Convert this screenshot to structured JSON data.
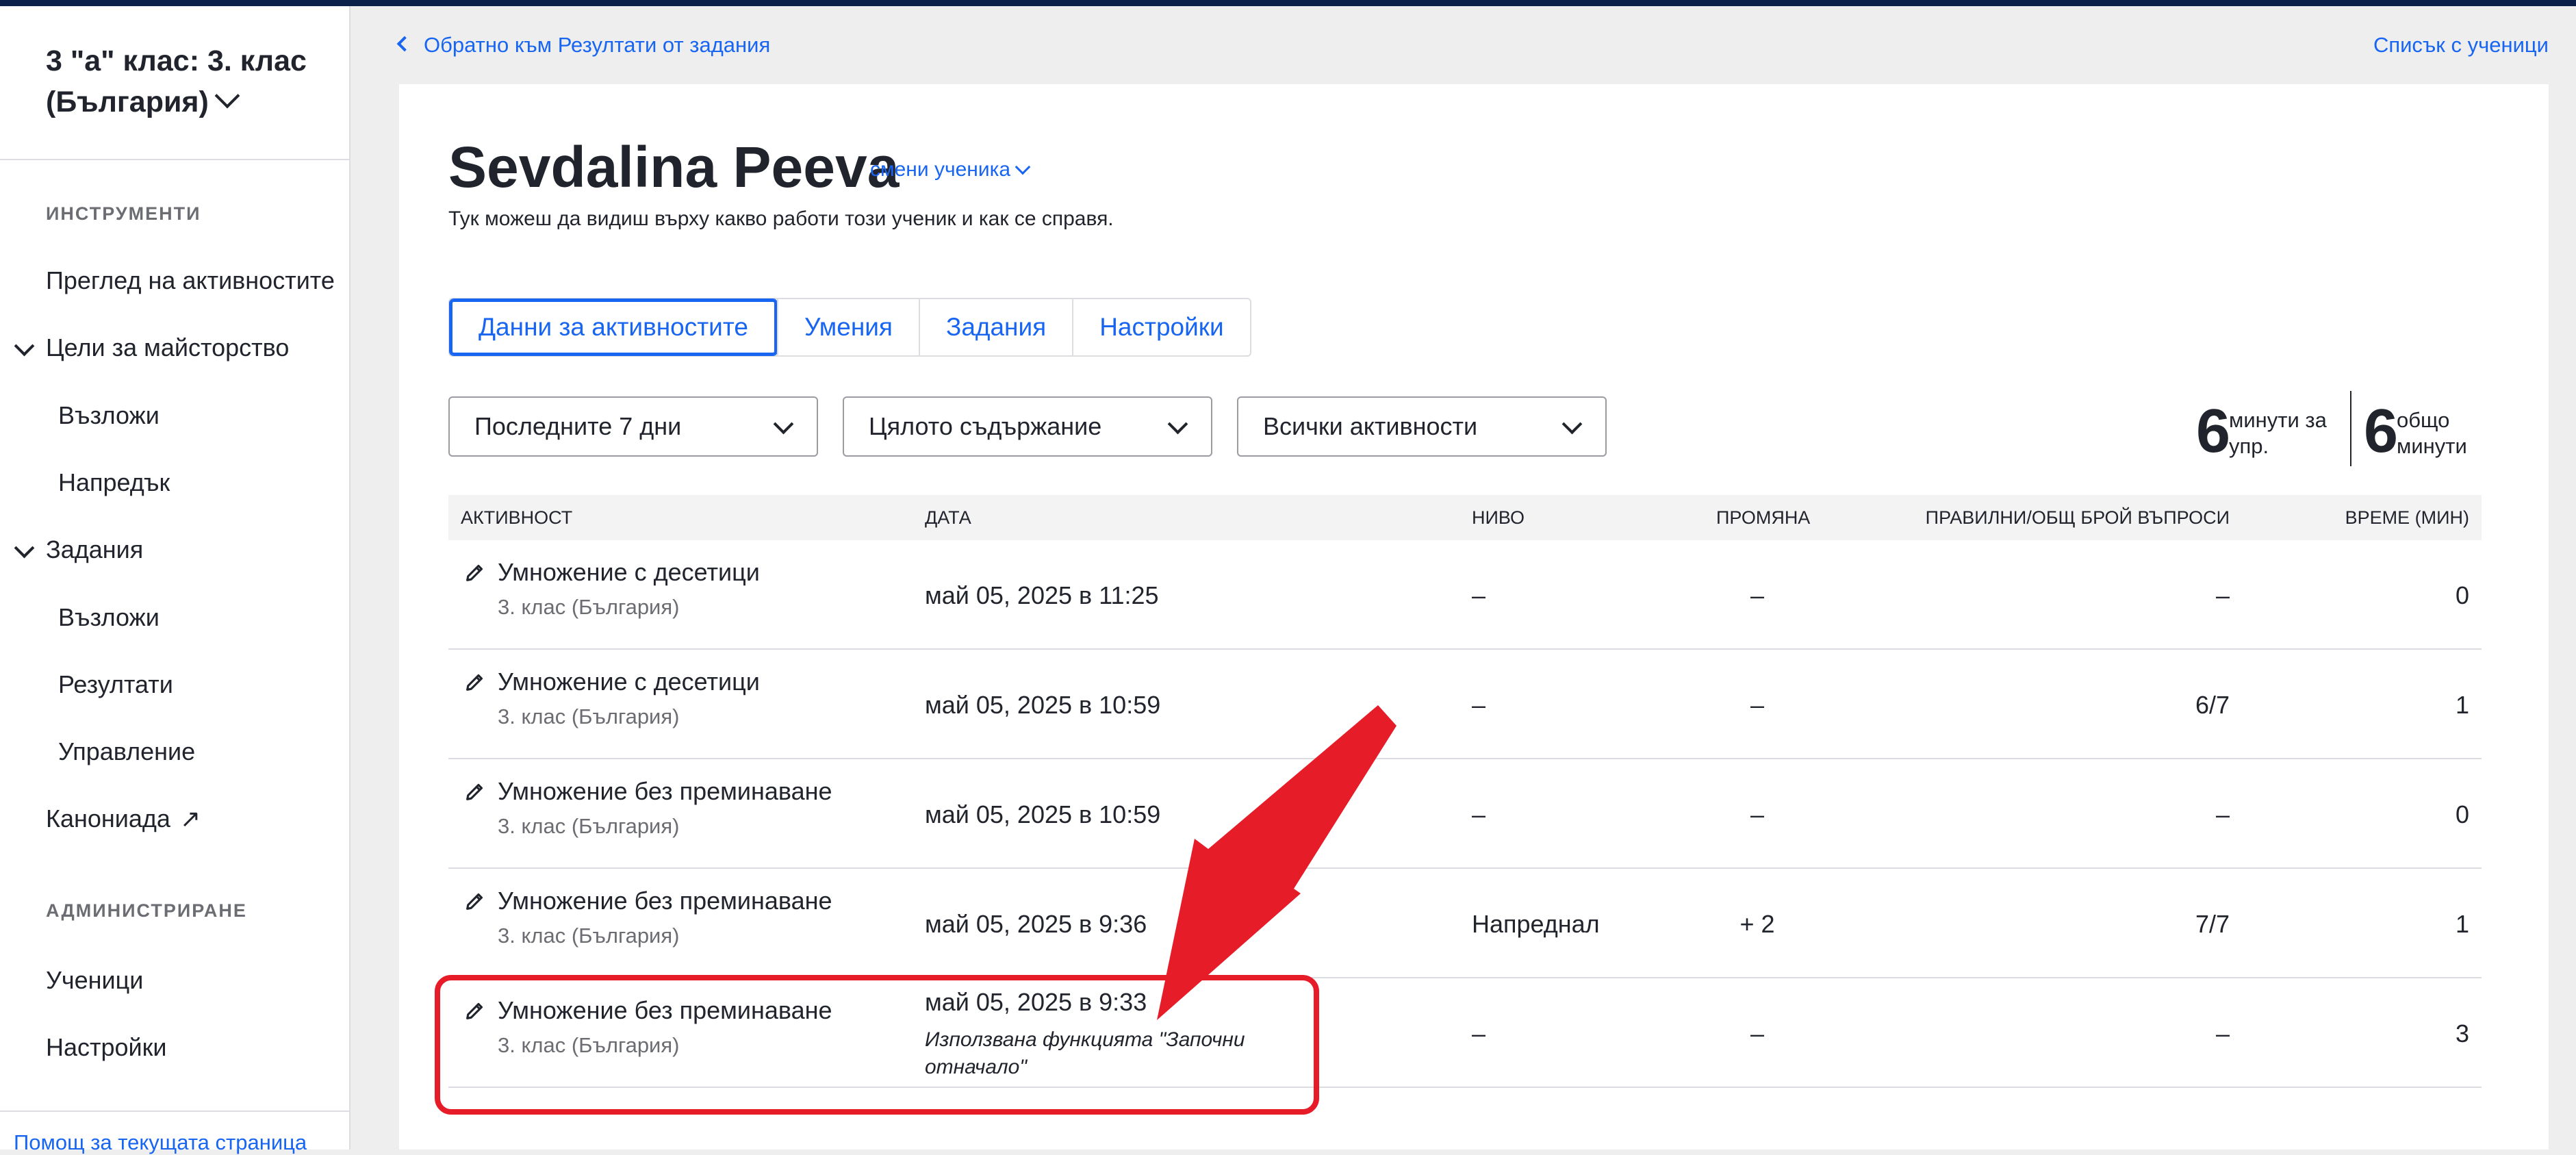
{
  "sidebar": {
    "class_title": "3 \"а\" клас: 3. клас (България)",
    "tools_label": "ИНСТРУМЕНТИ",
    "admin_label": "АДМИНИСТРИРАНЕ",
    "items": [
      {
        "label": "Преглед на активностите"
      },
      {
        "label": "Цели за майсторство"
      },
      {
        "label": "Възложи"
      },
      {
        "label": "Напредък"
      },
      {
        "label": "Задания"
      },
      {
        "label": "Възложи"
      },
      {
        "label": "Резултати"
      },
      {
        "label": "Управление"
      },
      {
        "label": "Канониада"
      },
      {
        "label": "Ученици"
      },
      {
        "label": "Настройки"
      }
    ],
    "help_link": "Помощ за текущата страница"
  },
  "header": {
    "back_link": "Обратно към Резултати от задания",
    "students_link": "Списък с ученици"
  },
  "student": {
    "name": "Sevdalina Peeva",
    "change_label": "смени ученика",
    "subtitle": "Тук можеш да видиш върху какво работи този ученик и как се справя."
  },
  "tabs": [
    {
      "label": "Данни за активностите",
      "active": true
    },
    {
      "label": "Умения",
      "active": false
    },
    {
      "label": "Задания",
      "active": false
    },
    {
      "label": "Настройки",
      "active": false
    }
  ],
  "filters": {
    "period": "Последните 7 дни",
    "content": "Цялото съдържание",
    "activities": "Всички активности"
  },
  "stats": {
    "exercise_minutes": "6",
    "exercise_label_1": "минути за",
    "exercise_label_2": "упр.",
    "total_minutes": "6",
    "total_label_1": "общо",
    "total_label_2": "минути"
  },
  "table": {
    "columns": [
      "АКТИВНОСТ",
      "ДАТА",
      "НИВО",
      "ПРОМЯНА",
      "ПРАВИЛНИ/ОБЩ БРОЙ ВЪПРОСИ",
      "ВРЕМЕ (МИН)"
    ],
    "rows": [
      {
        "title": "Умножение с десетици",
        "subtitle": "3. клас (България)",
        "date": "май 05, 2025 в 11:25",
        "level": "–",
        "change": "–",
        "correct": "–",
        "time": "0"
      },
      {
        "title": "Умножение с десетици",
        "subtitle": "3. клас (България)",
        "date": "май 05, 2025 в 10:59",
        "level": "–",
        "change": "–",
        "correct": "6/7",
        "time": "1"
      },
      {
        "title": "Умножение без преминаване",
        "subtitle": "3. клас (България)",
        "date": "май 05, 2025 в 10:59",
        "level": "–",
        "change": "–",
        "correct": "–",
        "time": "0"
      },
      {
        "title": "Умножение без преминаване",
        "subtitle": "3. клас (България)",
        "date": "май 05, 2025 в 9:36",
        "level": "Напреднал",
        "change": "+ 2",
        "correct": "7/7",
        "time": "1"
      },
      {
        "title": "Умножение без преминаване",
        "subtitle": "3. клас (България)",
        "date": "май 05, 2025 в 9:33",
        "note": "Използвана функцията \"Започни отначало\"",
        "level": "–",
        "change": "–",
        "correct": "–",
        "time": "3"
      }
    ]
  },
  "colors": {
    "link": "#1865f2",
    "annotation": "#e61c28",
    "topbar": "#0b2149"
  }
}
